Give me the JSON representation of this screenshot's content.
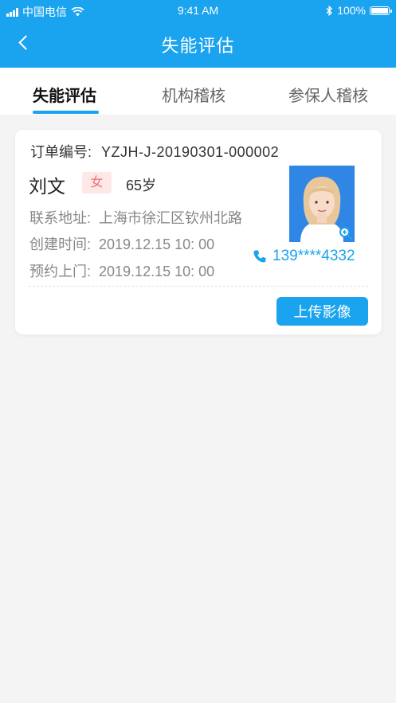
{
  "status_bar": {
    "carrier": "中国电信",
    "time": "9:41 AM",
    "battery": "100%"
  },
  "nav": {
    "title": "失能评估",
    "back_icon": "chevron-left-icon"
  },
  "tabs": [
    {
      "label": "失能评估",
      "active": true
    },
    {
      "label": "机构稽核",
      "active": false
    },
    {
      "label": "参保人稽核",
      "active": false
    }
  ],
  "card": {
    "order_label": "订单编号:",
    "order_number": "YZJH-J-20190301-000002",
    "name": "刘文",
    "gender": "女",
    "age": "65岁",
    "address_label": "联系地址:",
    "address": "上海市徐汇区钦州北路",
    "created_label": "创建时间:",
    "created": "2019.12.15 10: 00",
    "appointment_label": "预约上门:",
    "appointment": "2019.12.15 10: 00",
    "phone": "139****4332",
    "upload_label": "上传影像"
  },
  "colors": {
    "accent": "#1aa3ee",
    "gender_bg": "#fde7e7",
    "gender_text": "#f07070"
  }
}
